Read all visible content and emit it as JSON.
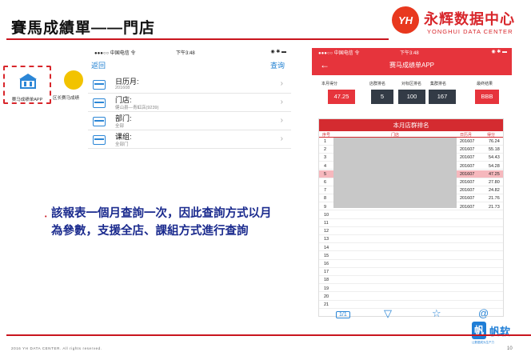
{
  "slide": {
    "title": "賽馬成績單——門店",
    "logo": {
      "badge": "YH",
      "cn": "永辉数据中心",
      "en": "YONGHUI DATA CENTER"
    },
    "footer": {
      "copyright": "2016 YH DATA CENTER. All rights reserved.",
      "page": "10"
    },
    "fanruan": {
      "mark": "帆",
      "name": "帆软",
      "tagline": "让数据成为生产力"
    }
  },
  "apps": [
    {
      "label": "赛马成绩单APP"
    },
    {
      "label": "区长赛马成绩"
    }
  ],
  "phone1": {
    "status": {
      "carrier": "●●●○○ 中国电信 令",
      "time": "下午3:48",
      "right": "◉ ✱ ▬"
    },
    "nav": {
      "back": "返回",
      "query": "查询"
    },
    "rows": [
      {
        "label": "日历月:",
        "value": "201608"
      },
      {
        "label": "门店:",
        "value": "健山县—青虹店(9239)"
      },
      {
        "label": "部门:",
        "value": "全部"
      },
      {
        "label": "课组:",
        "value": "全部门"
      }
    ]
  },
  "bullet": {
    "text": "該報表一個月查詢一次，因此查詢方式以月為參數，支援全店、課組方式進行查詢"
  },
  "phone2": {
    "status": {
      "carrier": "●●●○○ 中国电信 令",
      "time": "下午3:48",
      "right": "◉ ✱ ▬"
    },
    "nav": {
      "back": "←",
      "title": "赛马成绩单APP"
    },
    "headers": [
      "本月得分",
      "店群排名",
      "对标区排名",
      "集群排名",
      "最终结果"
    ],
    "values": [
      "47.25",
      "5",
      "100",
      "167",
      "BBB"
    ],
    "board": {
      "title": "本月店群排名",
      "columns": [
        "序号",
        "门店",
        "日历月",
        "得分"
      ],
      "rows": [
        {
          "n": "1",
          "month": "201607",
          "score": "76.24"
        },
        {
          "n": "2",
          "month": "201607",
          "score": "55.18"
        },
        {
          "n": "3",
          "month": "201607",
          "score": "54.43"
        },
        {
          "n": "4",
          "month": "201607",
          "score": "54.28"
        },
        {
          "n": "5",
          "month": "201607",
          "score": "47.25"
        },
        {
          "n": "6",
          "month": "201607",
          "score": "27.80"
        },
        {
          "n": "7",
          "month": "201607",
          "score": "24.82"
        },
        {
          "n": "8",
          "month": "201607",
          "score": "21.76"
        },
        {
          "n": "9",
          "month": "201607",
          "score": "21.73"
        },
        {
          "n": "10",
          "month": "",
          "score": ""
        },
        {
          "n": "11",
          "month": "",
          "score": ""
        },
        {
          "n": "12",
          "month": "",
          "score": ""
        },
        {
          "n": "13",
          "month": "",
          "score": ""
        },
        {
          "n": "14",
          "month": "",
          "score": ""
        },
        {
          "n": "15",
          "month": "",
          "score": ""
        },
        {
          "n": "16",
          "month": "",
          "score": ""
        },
        {
          "n": "17",
          "month": "",
          "score": ""
        },
        {
          "n": "18",
          "month": "",
          "score": ""
        },
        {
          "n": "19",
          "month": "",
          "score": ""
        },
        {
          "n": "20",
          "month": "",
          "score": ""
        },
        {
          "n": "21",
          "month": "",
          "score": ""
        }
      ]
    },
    "tabs": [
      "1/1",
      "▽",
      "☆",
      "@"
    ]
  },
  "colors": {
    "accent": "#d8262b",
    "nav_blue": "#1e7fd1",
    "bullet": "#1b2b8e"
  }
}
